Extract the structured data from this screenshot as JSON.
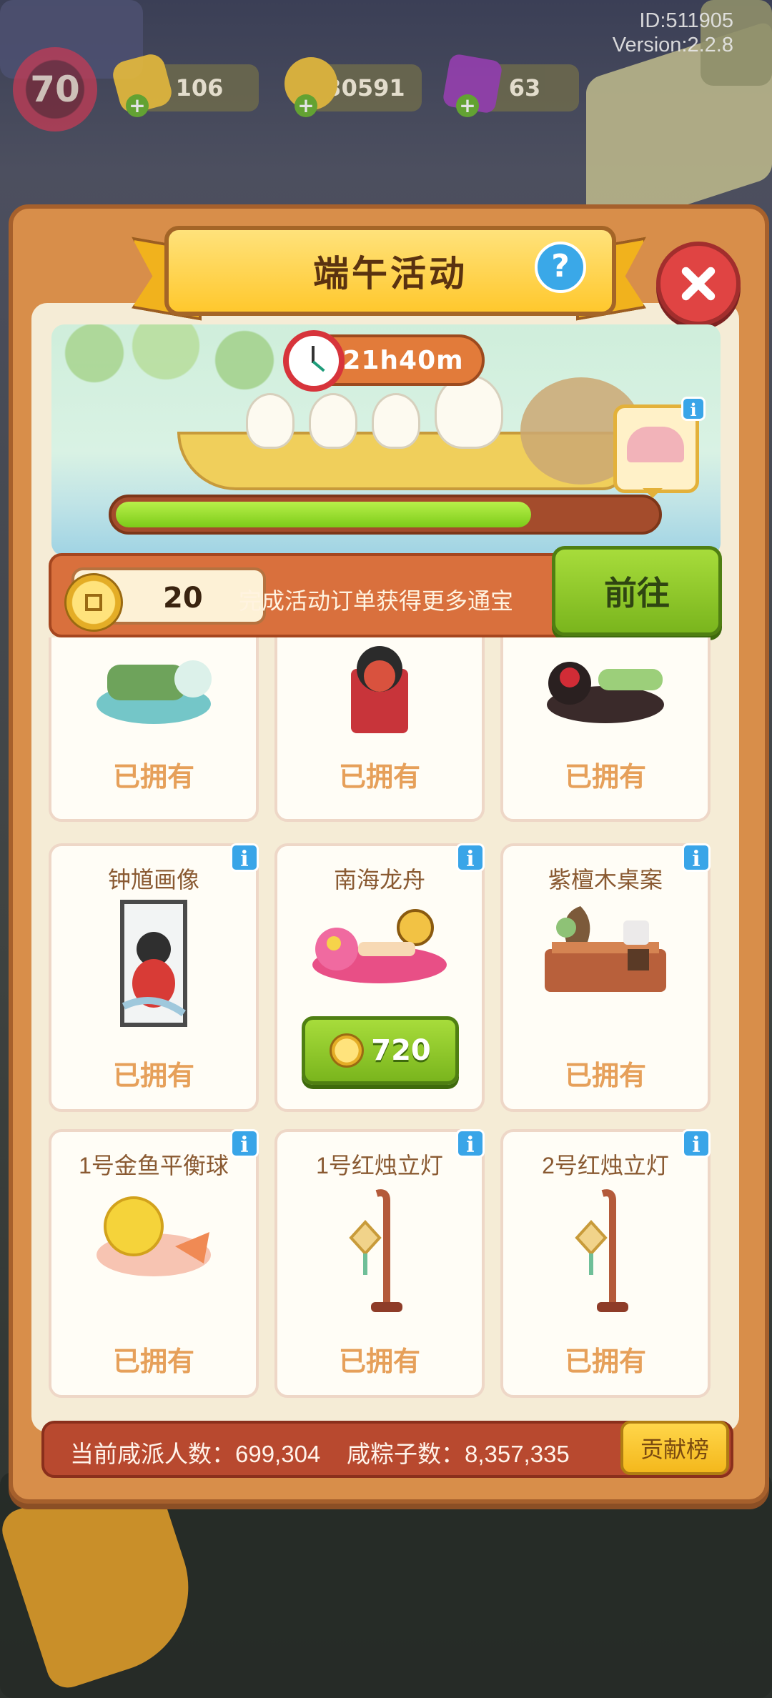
{
  "hud": {
    "player_id": "ID:511905",
    "version": "Version:2.2.8",
    "level": "70",
    "energy": "106",
    "coins": "30591",
    "gems": "63"
  },
  "panel": {
    "title": "端午活动",
    "timer": "21h40m",
    "progress_fraction": 0.77
  },
  "task": {
    "tokens": "20",
    "description": "完成活动订单获得更多通宝",
    "go_label": "前往"
  },
  "grid": {
    "top_row": [
      {
        "owned_label": "已拥有"
      },
      {
        "owned_label": "已拥有"
      },
      {
        "owned_label": "已拥有"
      }
    ],
    "middle_row": [
      {
        "name": "钟馗画像",
        "owned_label": "已拥有"
      },
      {
        "name": "南海龙舟",
        "price": "720"
      },
      {
        "name": "紫檀木桌案",
        "owned_label": "已拥有"
      }
    ],
    "bottom_row": [
      {
        "name": "1号金鱼平衡球",
        "owned_label": "已拥有"
      },
      {
        "name": "1号红烛立灯",
        "owned_label": "已拥有"
      },
      {
        "name": "2号红烛立灯",
        "owned_label": "已拥有"
      }
    ]
  },
  "footer": {
    "stats": "当前咸派人数：699,304    咸粽子数：8,357,335",
    "rank_label": "贡献榜"
  },
  "colors": {
    "panel": "#d88e4a",
    "accent_green": "#7ab51d",
    "title_yellow": "#ffc82d",
    "owned_text": "#e6a05a"
  }
}
